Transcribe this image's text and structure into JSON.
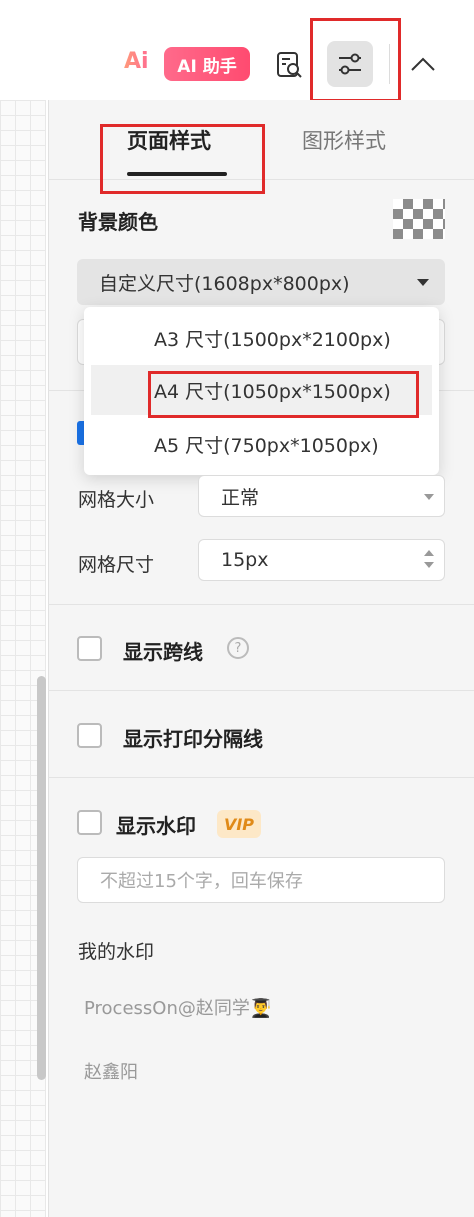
{
  "toolbar": {
    "ai_logo": "Ai",
    "ai_button": "AI 助手",
    "icons": [
      "ai-logo-icon",
      "search-doc-icon",
      "settings-sliders-icon",
      "chevron-up-icon"
    ],
    "colors": {
      "ai_gradient_start": "#ff6a8b",
      "ai_gradient_end": "#ff4b70",
      "active_bg": "#e3e3e3",
      "annotation_red": "#e02a2a"
    }
  },
  "tabs": [
    {
      "label": "页面样式",
      "active": true
    },
    {
      "label": "图形样式",
      "active": false
    }
  ],
  "background": {
    "title": "背景颜色",
    "color_swatch": "checker-transparent-icon"
  },
  "page_size": {
    "selected": "自定义尺寸(1608px*800px)",
    "options": [
      {
        "label": "A3 尺寸(1500px*2100px)",
        "hovered": false
      },
      {
        "label": "A4 尺寸(1050px*1500px)",
        "hovered": true
      },
      {
        "label": "A5 尺寸(750px*1050px)",
        "hovered": false
      }
    ]
  },
  "grid": {
    "size_label": "网格大小",
    "size_value": "正常",
    "spacing_label": "网格尺寸",
    "spacing_value": "15px"
  },
  "options": {
    "show_crossline": "显示跨线",
    "show_print_divider": "显示打印分隔线",
    "show_watermark": "显示水印",
    "vip_badge": "VIP",
    "watermark_placeholder": "不超过15个字，回车保存"
  },
  "my_watermarks": {
    "title": "我的水印",
    "items": [
      "ProcessOn@赵同学👨‍🎓",
      "赵鑫阳"
    ]
  },
  "help_glyph": "?"
}
